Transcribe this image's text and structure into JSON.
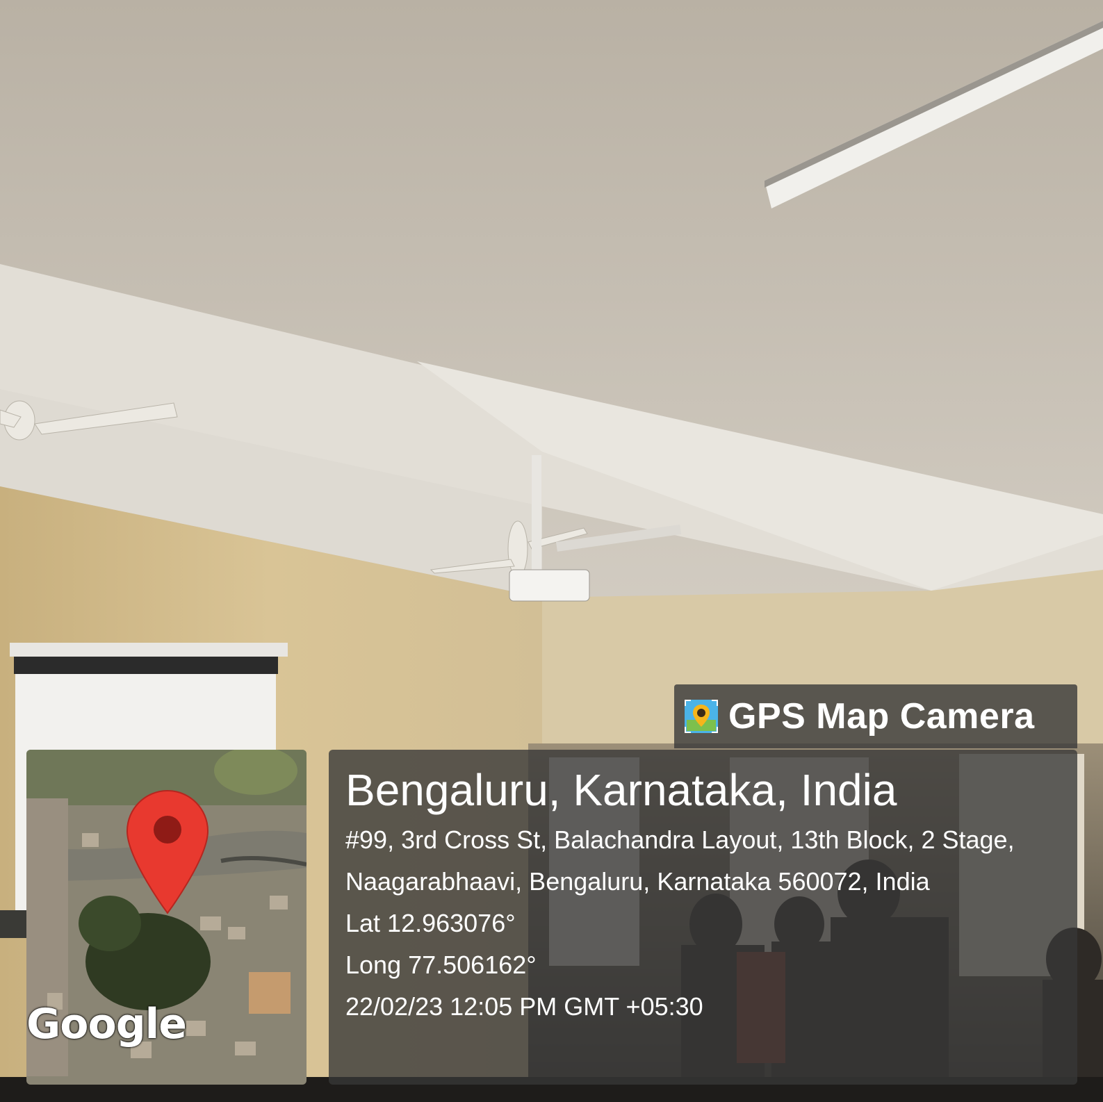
{
  "overlay": {
    "app_name": "GPS Map Camera",
    "app_icon": "gps-map-camera-icon",
    "location_title": "Bengaluru, Karnataka, India",
    "address": "#99, 3rd Cross St, Balachandra Layout, 13th Block, 2 Stage, Naagarabhaavi, Bengaluru, Karnataka 560072, India",
    "latitude": "Lat 12.963076°",
    "longitude": "Long 77.506162°",
    "datetime": "22/02/23 12:05 PM GMT +05:30",
    "map_watermark": "Google",
    "map_pin_icon": "map-pin-icon",
    "pin_color": "#e8392f"
  }
}
